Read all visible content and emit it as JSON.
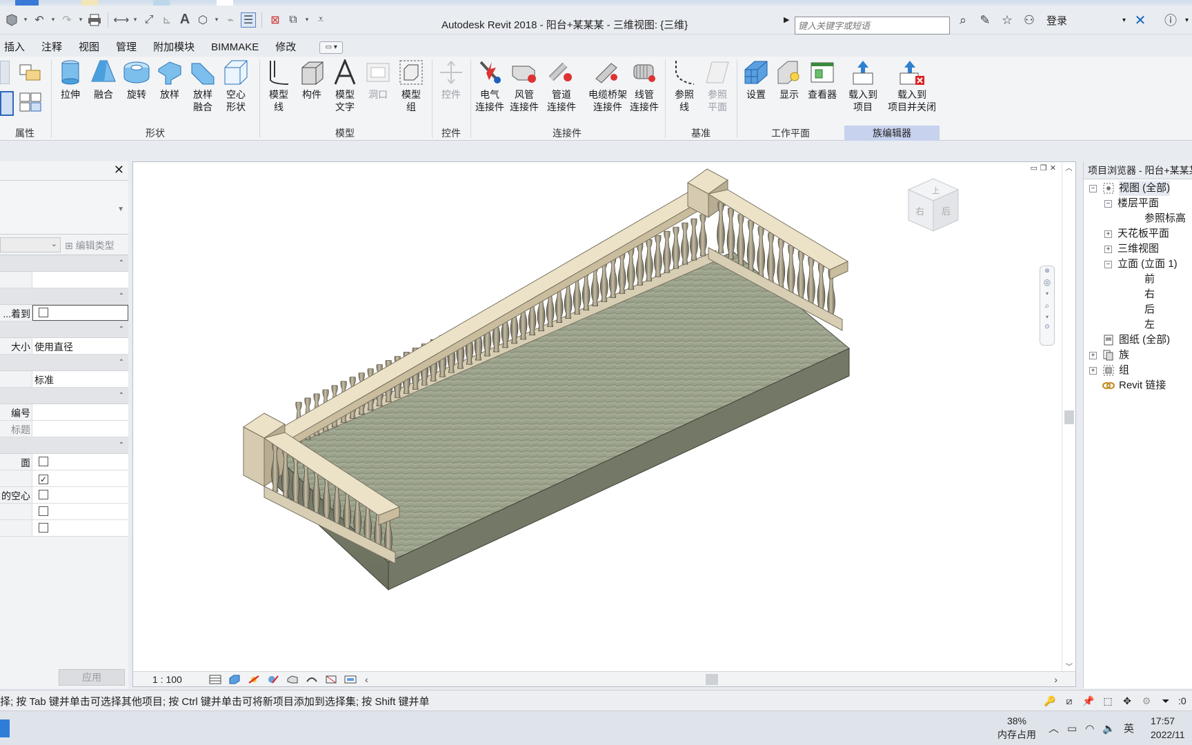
{
  "titlebar": {
    "title": "Autodesk Revit 2018 -     阳台+某某某 - 三维视图: {三维}",
    "search_placeholder": "键入关键字或短语",
    "login": "登录"
  },
  "menu": {
    "tabs": [
      "插入",
      "注释",
      "视图",
      "管理",
      "附加模块",
      "BIMMAKE",
      "修改"
    ]
  },
  "ribbon": {
    "groups": {
      "properties": "属性",
      "forms": "形状",
      "model": "模型",
      "controls": "控件",
      "connectors": "连接件",
      "datum": "基准",
      "workplane": "工作平面",
      "family_editor": "族编辑器"
    },
    "buttons": {
      "extrusion": "拉伸",
      "blend": "融合",
      "revolve": "旋转",
      "sweep": "放样",
      "swept_blend": "放样\n融合",
      "void_forms": "空心\n形状",
      "model_line": "模型\n线",
      "component": "构件",
      "model_text": "模型\n文字",
      "opening": "洞口",
      "model_group": "模型\n组",
      "control": "控件",
      "electrical_connector": "电气\n连接件",
      "duct_connector": "风管\n连接件",
      "pipe_connector": "管道\n连接件",
      "cable_tray_connector": "电缆桥架\n连接件",
      "conduit_connector": "线管\n连接件",
      "ref_line": "参照\n线",
      "ref_plane": "参照\n平面",
      "set": "设置",
      "show": "显示",
      "viewer": "查看器",
      "load_into_project": "载入到\n项目",
      "load_into_project_close": "载入到\n项目并关闭"
    }
  },
  "properties": {
    "edit_type": "编辑类型",
    "rows": [
      {
        "label": "",
        "value": ""
      },
      {
        "label": "着到...",
        "value": ""
      },
      {
        "label": "大小",
        "value": "使用直径"
      },
      {
        "label": "",
        "value": "标准"
      },
      {
        "label": "编号",
        "value": ""
      },
      {
        "label": "标题",
        "value": ""
      },
      {
        "label": "面",
        "value": ""
      },
      {
        "label": "",
        "value": ""
      },
      {
        "label": "的空心",
        "value": ""
      },
      {
        "label": "",
        "value": ""
      },
      {
        "label": "",
        "value": ""
      }
    ],
    "apply": "应用"
  },
  "viewport": {
    "scale": "1 : 100",
    "viewcube_faces": [
      "上",
      "右",
      "后"
    ]
  },
  "ime": {
    "text": "英 ;"
  },
  "browser": {
    "header": "项目浏览器 - 阳台+某某某",
    "items": {
      "views_all": "视图 (全部)",
      "floor_plans": "楼层平面",
      "ref_level": "参照标高",
      "ceiling_plans": "天花板平面",
      "3d_views": "三维视图",
      "elevations": "立面 (立面 1)",
      "front": "前",
      "right": "右",
      "back": "后",
      "left": "左",
      "sheets_all": "图纸 (全部)",
      "families": "族",
      "groups": "组",
      "revit_links": "Revit 链接"
    }
  },
  "statusbar": {
    "text": "择; 按 Tab 键并单击可选择其他项目; 按 Ctrl 键并单击可将新项目添加到选择集; 按 Shift 键并单",
    "filter_count": ":0"
  },
  "taskbar": {
    "mem_percent": "38%",
    "mem_label": "内存占用",
    "time": "17:57",
    "date": "2022/11"
  },
  "colors": {
    "active_group": "#c7d2ee",
    "ribbon_blue": "#2f7fcf",
    "rail_color": "#e6dcc4",
    "floor_color": "#9aa089"
  }
}
